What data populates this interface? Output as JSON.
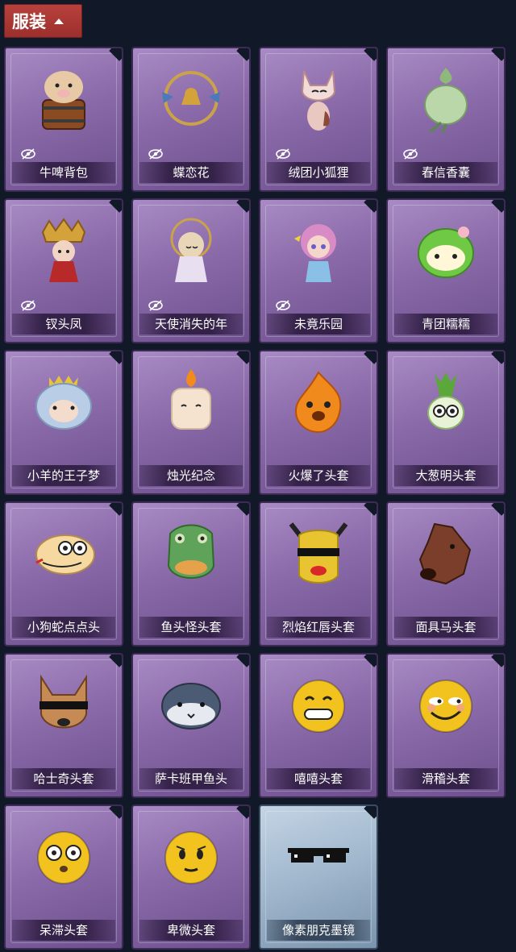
{
  "header": {
    "title": "服装"
  },
  "items": [
    {
      "name": "牛啤背包",
      "hidden": true,
      "style": "purple",
      "icon": "cow-beer-backpack-icon",
      "color": "#e8c9a5"
    },
    {
      "name": "蝶恋花",
      "hidden": true,
      "style": "purple",
      "icon": "butterfly-bell-icon",
      "color": "#c9a24a"
    },
    {
      "name": "绒团小狐狸",
      "hidden": true,
      "style": "purple",
      "icon": "fox-icon",
      "color": "#f1dcd8"
    },
    {
      "name": "春信香囊",
      "hidden": true,
      "style": "purple",
      "icon": "sachet-icon",
      "color": "#b9d7a8"
    },
    {
      "name": "钗头凤",
      "hidden": true,
      "style": "purple",
      "icon": "phoenix-crown-doll-icon",
      "color": "#d4a23a"
    },
    {
      "name": "天使消失的年",
      "hidden": true,
      "style": "purple",
      "icon": "angel-doll-icon",
      "color": "#e9d6b8"
    },
    {
      "name": "未竟乐园",
      "hidden": true,
      "style": "purple",
      "icon": "paradise-doll-icon",
      "color": "#d88bc4"
    },
    {
      "name": "青团糯糯",
      "hidden": false,
      "style": "purple",
      "icon": "green-rice-ball-icon",
      "color": "#6fc944"
    },
    {
      "name": "小羊的王子梦",
      "hidden": false,
      "style": "purple",
      "icon": "sheep-prince-icon",
      "color": "#b9cde6"
    },
    {
      "name": "烛光纪念",
      "hidden": false,
      "style": "purple",
      "icon": "candle-icon",
      "color": "#f5e3cf"
    },
    {
      "name": "火爆了头套",
      "hidden": false,
      "style": "purple",
      "icon": "fire-head-icon",
      "color": "#f08a1c"
    },
    {
      "name": "大葱明头套",
      "hidden": false,
      "style": "purple",
      "icon": "scallion-head-icon",
      "color": "#8cc865"
    },
    {
      "name": "小狗蛇点点头",
      "hidden": false,
      "style": "purple",
      "icon": "snake-head-icon",
      "color": "#f5d9a0"
    },
    {
      "name": "鱼头怪头套",
      "hidden": false,
      "style": "purple",
      "icon": "fish-monster-head-icon",
      "color": "#5fa35a"
    },
    {
      "name": "烈焰红唇头套",
      "hidden": false,
      "style": "purple",
      "icon": "red-lips-mask-icon",
      "color": "#e8c530"
    },
    {
      "name": "面具马头套",
      "hidden": false,
      "style": "purple",
      "icon": "horse-mask-icon",
      "color": "#7a3e2a"
    },
    {
      "name": "哈士奇头套",
      "hidden": false,
      "style": "purple",
      "icon": "husky-head-icon",
      "color": "#c68a55"
    },
    {
      "name": "萨卡班甲鱼头",
      "hidden": false,
      "style": "purple",
      "icon": "sacabambaspis-head-icon",
      "color": "#4b5b73"
    },
    {
      "name": "嘻嘻头套",
      "hidden": false,
      "style": "purple",
      "icon": "grin-emoji-head-icon",
      "color": "#f2c21e"
    },
    {
      "name": "滑稽头套",
      "hidden": false,
      "style": "purple",
      "icon": "funny-emoji-head-icon",
      "color": "#f2c21e"
    },
    {
      "name": "呆滞头套",
      "hidden": false,
      "style": "purple",
      "icon": "dazed-emoji-head-icon",
      "color": "#f2c21e"
    },
    {
      "name": "卑微头套",
      "hidden": false,
      "style": "purple",
      "icon": "humble-emoji-head-icon",
      "color": "#f2c21e"
    },
    {
      "name": "像素朋克墨镜",
      "hidden": false,
      "style": "blue",
      "icon": "pixel-sunglasses-icon",
      "color": "#111111"
    }
  ]
}
